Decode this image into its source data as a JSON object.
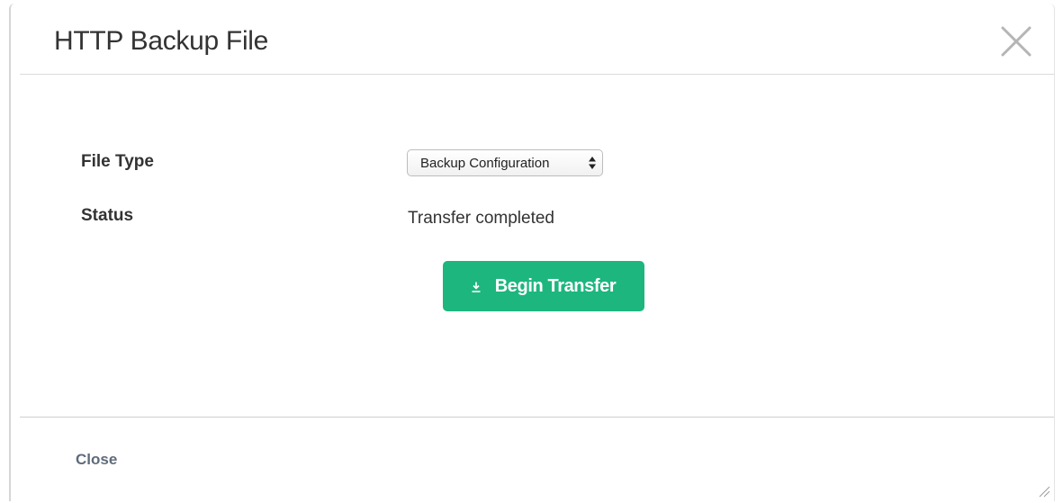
{
  "dialog": {
    "title": "HTTP Backup File",
    "close_icon": "close-x-icon"
  },
  "form": {
    "file_type_label": "File Type",
    "file_type_selected": "Backup Configuration",
    "status_label": "Status",
    "status_value": "Transfer completed"
  },
  "actions": {
    "begin_transfer_label": "Begin Transfer",
    "begin_transfer_icon": "download-icon",
    "close_label": "Close"
  },
  "colors": {
    "primary_button": "#1db67f",
    "close_link": "#5f6b7a"
  }
}
